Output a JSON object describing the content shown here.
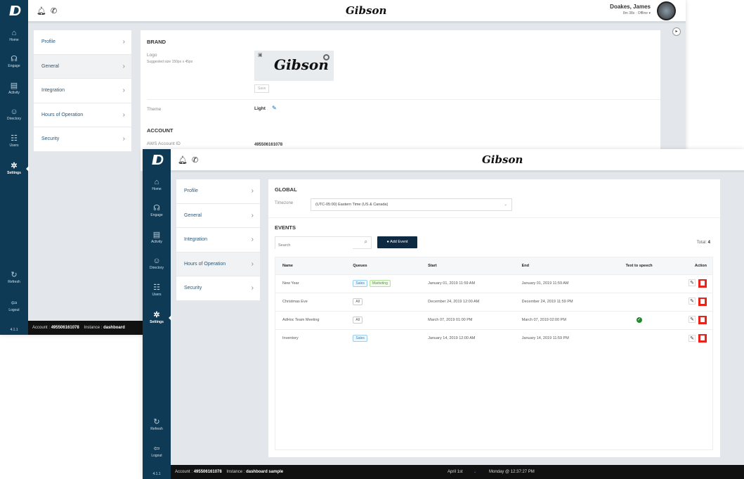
{
  "brand": "Gibson",
  "nav": [
    {
      "label": "Home",
      "icon": "home-icon",
      "g": "⌂"
    },
    {
      "label": "Engage",
      "icon": "headset-icon",
      "g": "☊"
    },
    {
      "label": "Activity",
      "icon": "activity-icon",
      "g": "▤"
    },
    {
      "label": "Directory",
      "icon": "directory-icon",
      "g": "☺"
    },
    {
      "label": "Users",
      "icon": "users-icon",
      "g": "☷"
    },
    {
      "label": "Settings",
      "icon": "settings-icon",
      "g": "✲"
    }
  ],
  "nav_bottom": [
    {
      "label": "Refresh",
      "icon": "refresh-icon",
      "g": "↻"
    },
    {
      "label": "Logout",
      "icon": "logout-icon",
      "g": "⇦"
    }
  ],
  "version": "4.1.1",
  "settings_menu": [
    "Profile",
    "General",
    "Integration",
    "Hours of Operation",
    "Security"
  ],
  "user": {
    "name": "Doakes, James",
    "status": "8m 38s · Offline ▾"
  },
  "back": {
    "brand_heading": "BRAND",
    "logo_label": "Logo",
    "logo_hint": "Suggested size 150px x 45px",
    "save": "Save",
    "theme_label": "Theme",
    "theme_value": "Light",
    "account_heading": "ACCOUNT",
    "aws_label": "AWS Account ID",
    "aws_value": "495506161078",
    "status_account_label": "Account :",
    "status_account": "495506161078",
    "status_instance_label": "Instance :",
    "status_instance": "dashboard"
  },
  "front": {
    "global_heading": "GLOBAL",
    "timezone_label": "Timezone",
    "timezone_value": "(UTC-05:00) Eastern Time (US & Canada)",
    "events_heading": "EVENTS",
    "search_placeholder": "Search",
    "add_event": "Add Event",
    "total_label": "Total:",
    "total_value": "4",
    "columns": [
      "Name",
      "Queues",
      "Start",
      "End",
      "Text to speech",
      "Action"
    ],
    "rows": [
      {
        "name": "New Year",
        "queues": [
          "Sales",
          "Marketing"
        ],
        "start": "January 01, 2019 11:59 AM",
        "end": "January 01, 2019 11:59 AM",
        "tts": false
      },
      {
        "name": "Christmas Eve",
        "queues": [
          "All"
        ],
        "start": "December 24, 2019 12:00 AM",
        "end": "December 24, 2019 11:59 PM",
        "tts": false
      },
      {
        "name": "AdHoc Team Meeting",
        "queues": [
          "All"
        ],
        "start": "March 07, 2019 01:00 PM",
        "end": "March 07, 2019 02:00 PM",
        "tts": true
      },
      {
        "name": "Inventory",
        "queues": [
          "Sales"
        ],
        "start": "January 14, 2019 12:00 AM",
        "end": "January 14, 2019 11:59 PM",
        "tts": false
      }
    ],
    "status_account_label": "Account :",
    "status_account": "495506161078",
    "status_instance_label": "Instance :",
    "status_instance": "dashboard sample",
    "status_date": "April 1st",
    "status_time": "Monday @ 12:37:27 PM"
  }
}
